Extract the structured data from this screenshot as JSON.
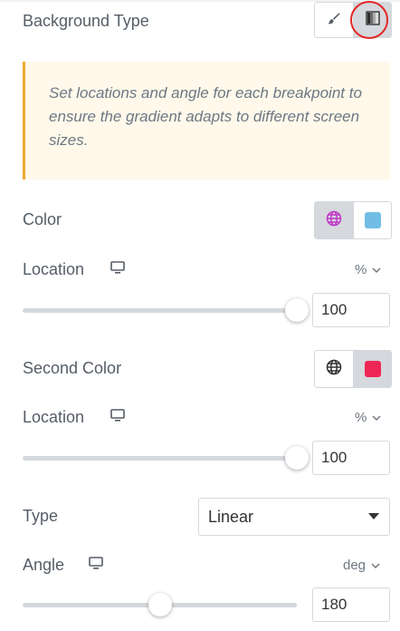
{
  "background_type": {
    "label": "Background Type",
    "options": [
      {
        "icon": "brush-icon",
        "active": false
      },
      {
        "icon": "gradient-icon",
        "active": true
      }
    ]
  },
  "notice": {
    "text": "Set locations and angle for each breakpoint to ensure the gradient adapts to different screen sizes."
  },
  "color": {
    "label": "Color",
    "swatch": "#71bde6",
    "global_active": true
  },
  "location1": {
    "label": "Location",
    "unit": "%",
    "value": "100",
    "fraction": 1.0
  },
  "second_color": {
    "label": "Second Color",
    "swatch": "#ef2756",
    "global_active": false
  },
  "location2": {
    "label": "Location",
    "unit": "%",
    "value": "100",
    "fraction": 1.0
  },
  "type": {
    "label": "Type",
    "selected": "Linear"
  },
  "angle": {
    "label": "Angle",
    "unit": "deg",
    "value": "180",
    "fraction": 0.5
  },
  "colors": {
    "accent_highlight": "#e32727",
    "notice_border": "#f0a830",
    "notice_bg": "#fff8eb",
    "global_icon_active": "#c036c8"
  }
}
